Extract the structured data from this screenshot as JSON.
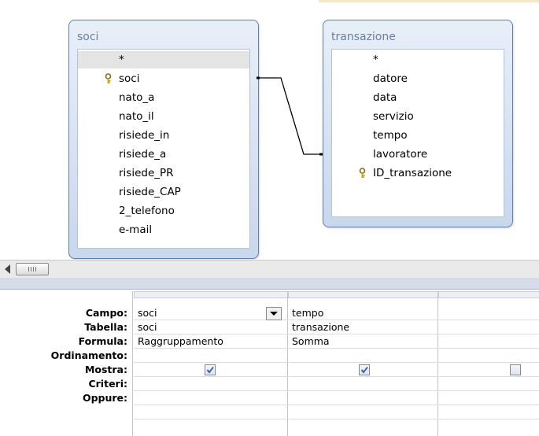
{
  "tables": [
    {
      "title": "soci",
      "fields": [
        {
          "label": "*",
          "primary_key": false,
          "selected": true
        },
        {
          "label": "soci",
          "primary_key": true,
          "selected": false
        },
        {
          "label": "nato_a",
          "primary_key": false,
          "selected": false
        },
        {
          "label": "nato_il",
          "primary_key": false,
          "selected": false
        },
        {
          "label": "risiede_in",
          "primary_key": false,
          "selected": false
        },
        {
          "label": "risiede_a",
          "primary_key": false,
          "selected": false
        },
        {
          "label": "risiede_PR",
          "primary_key": false,
          "selected": false
        },
        {
          "label": "risiede_CAP",
          "primary_key": false,
          "selected": false
        },
        {
          "label": "2_telefono",
          "primary_key": false,
          "selected": false
        },
        {
          "label": "e-mail",
          "primary_key": false,
          "selected": false
        }
      ]
    },
    {
      "title": "transazione",
      "fields": [
        {
          "label": "*",
          "primary_key": false,
          "selected": false
        },
        {
          "label": "datore",
          "primary_key": false,
          "selected": false
        },
        {
          "label": "data",
          "primary_key": false,
          "selected": false
        },
        {
          "label": "servizio",
          "primary_key": false,
          "selected": false
        },
        {
          "label": "tempo",
          "primary_key": false,
          "selected": false
        },
        {
          "label": "lavoratore",
          "primary_key": false,
          "selected": false
        },
        {
          "label": "ID_transazione",
          "primary_key": true,
          "selected": false
        }
      ]
    }
  ],
  "grid": {
    "row_labels": [
      "Campo:",
      "Tabella:",
      "Formula:",
      "Ordinamento:",
      "Mostra:",
      "Criteri:",
      "Oppure:"
    ],
    "columns": [
      {
        "campo": "soci",
        "tabella": "soci",
        "formula": "Raggruppamento",
        "ordinamento": "",
        "mostra": true,
        "criteri": "",
        "oppure": ""
      },
      {
        "campo": "tempo",
        "tabella": "transazione",
        "formula": "Somma",
        "ordinamento": "",
        "mostra": true,
        "criteri": "",
        "oppure": ""
      },
      {
        "campo": "",
        "tabella": "",
        "formula": "",
        "ordinamento": "",
        "mostra": false,
        "criteri": "",
        "oppure": ""
      }
    ]
  },
  "colors": {
    "table_border": "#5d7fb0",
    "table_title": "#6a7f9c",
    "key_icon": "#e8c040",
    "checkmark": "#2c5aa8"
  }
}
